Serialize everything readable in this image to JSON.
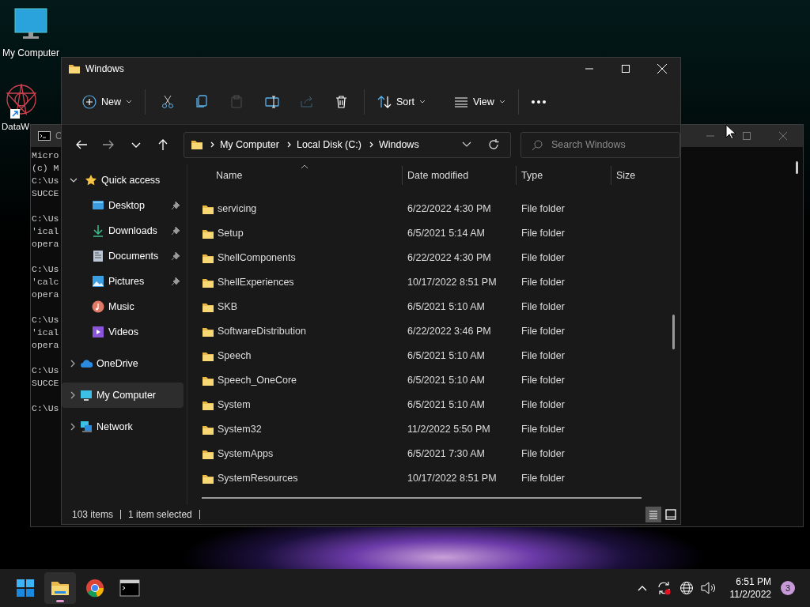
{
  "desktop_icons": [
    {
      "label": "My Computer"
    },
    {
      "label": "DataW"
    }
  ],
  "console": {
    "title": "C",
    "paragraphs": [
      [
        "Micro",
        "(c) M",
        "C:\\Us",
        "SUCCE"
      ],
      [
        "C:\\Us",
        "'ical",
        "opera"
      ],
      [
        "C:\\Us",
        "'calc",
        "opera"
      ],
      [
        "C:\\Us",
        "'ical",
        "opera"
      ],
      [
        "C:\\Us",
        "SUCCE"
      ],
      [
        "C:\\Us"
      ]
    ]
  },
  "explorer": {
    "title": "Windows",
    "toolbar": [
      {
        "kind": "dropdown",
        "label": "New",
        "disabled": false
      },
      {
        "kind": "separator"
      },
      {
        "kind": "icon",
        "disabled": false
      },
      {
        "kind": "icon",
        "disabled": false
      },
      {
        "kind": "icon",
        "disabled": true
      },
      {
        "kind": "icon",
        "disabled": false
      },
      {
        "kind": "icon",
        "disabled": true
      },
      {
        "kind": "icon",
        "disabled": false
      },
      {
        "kind": "separator"
      },
      {
        "kind": "dropdown",
        "label": "Sort",
        "disabled": false
      },
      {
        "kind": "dropdown",
        "label": "View",
        "disabled": false
      },
      {
        "kind": "separator"
      },
      {
        "kind": "more",
        "disabled": false
      }
    ],
    "breadcrumb": [
      "My Computer",
      "Local Disk (C:)",
      "Windows"
    ],
    "search": {
      "placeholder": "Search Windows"
    },
    "sidebar": [
      {
        "label": "Quick access",
        "expanded": true,
        "selected": false,
        "children": [
          {
            "label": "Desktop",
            "pinned": true,
            "selected": false
          },
          {
            "label": "Downloads",
            "pinned": true,
            "selected": false
          },
          {
            "label": "Documents",
            "pinned": true,
            "selected": false
          },
          {
            "label": "Pictures",
            "pinned": true,
            "selected": false
          },
          {
            "label": "Music",
            "pinned": false,
            "selected": false
          },
          {
            "label": "Videos",
            "pinned": false,
            "selected": false
          }
        ]
      },
      {
        "label": "OneDrive",
        "expanded": false,
        "selected": false
      },
      {
        "label": "My Computer",
        "expanded": false,
        "selected": true
      },
      {
        "label": "Network",
        "expanded": false,
        "selected": false
      }
    ],
    "columns": [
      "Name",
      "Date modified",
      "Type",
      "Size"
    ],
    "rows": [
      {
        "name": "servicing",
        "date": "6/22/2022 4:30 PM",
        "type": "File folder"
      },
      {
        "name": "Setup",
        "date": "6/5/2021 5:14 AM",
        "type": "File folder"
      },
      {
        "name": "ShellComponents",
        "date": "6/22/2022 4:30 PM",
        "type": "File folder"
      },
      {
        "name": "ShellExperiences",
        "date": "10/17/2022 8:51 PM",
        "type": "File folder"
      },
      {
        "name": "SKB",
        "date": "6/5/2021 5:10 AM",
        "type": "File folder"
      },
      {
        "name": "SoftwareDistribution",
        "date": "6/22/2022 3:46 PM",
        "type": "File folder"
      },
      {
        "name": "Speech",
        "date": "6/5/2021 5:10 AM",
        "type": "File folder"
      },
      {
        "name": "Speech_OneCore",
        "date": "6/5/2021 5:10 AM",
        "type": "File folder"
      },
      {
        "name": "System",
        "date": "6/5/2021 5:10 AM",
        "type": "File folder"
      },
      {
        "name": "System32",
        "date": "11/2/2022 5:50 PM",
        "type": "File folder"
      },
      {
        "name": "SystemApps",
        "date": "6/5/2021 7:30 AM",
        "type": "File folder"
      },
      {
        "name": "SystemResources",
        "date": "10/17/2022 8:51 PM",
        "type": "File folder"
      }
    ],
    "status": {
      "count": "103 items",
      "selection": "1 item selected"
    },
    "views": [
      {
        "selected": true
      },
      {
        "selected": false
      }
    ]
  },
  "taskbar": {
    "apps": [
      {
        "active": false
      },
      {
        "active": true
      },
      {
        "active": false
      },
      {
        "active": false
      }
    ],
    "time": "6:51 PM",
    "date": "11/2/2022",
    "notifications": "3"
  }
}
